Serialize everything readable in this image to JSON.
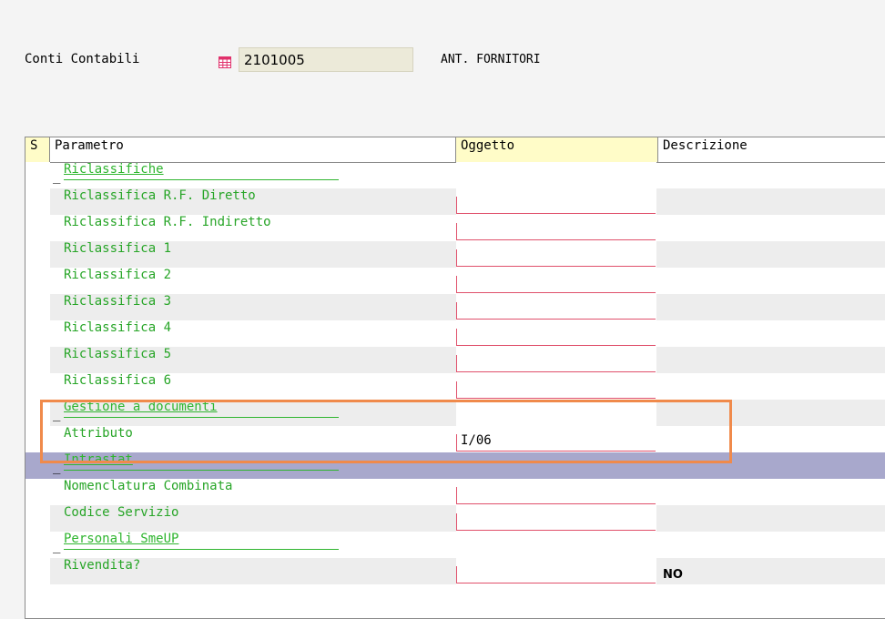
{
  "header": {
    "label": "Conti Contabili",
    "code": "2101005",
    "description": "ANT. FORNITORI"
  },
  "grid": {
    "columns": {
      "s": "S",
      "parametro": "Parametro",
      "oggetto": "Oggetto",
      "descrizione": "Descrizione"
    },
    "rows": [
      {
        "type": "section",
        "label": "Riclassifiche",
        "marker": "_"
      },
      {
        "type": "param",
        "label": "Riclassifica R.F. Diretto",
        "value": "",
        "desc": ""
      },
      {
        "type": "param",
        "label": "Riclassifica R.F. Indiretto",
        "value": "",
        "desc": ""
      },
      {
        "type": "param",
        "label": "Riclassifica 1",
        "value": "",
        "desc": ""
      },
      {
        "type": "param",
        "label": "Riclassifica 2",
        "value": "",
        "desc": ""
      },
      {
        "type": "param",
        "label": "Riclassifica 3",
        "value": "",
        "desc": ""
      },
      {
        "type": "param",
        "label": "Riclassifica 4",
        "value": "",
        "desc": ""
      },
      {
        "type": "param",
        "label": "Riclassifica 5",
        "value": "",
        "desc": ""
      },
      {
        "type": "param",
        "label": "Riclassifica 6",
        "value": "",
        "desc": ""
      },
      {
        "type": "section",
        "label": "Gestione a documenti",
        "marker": "_"
      },
      {
        "type": "param",
        "label": "Attributo",
        "value": "I/06",
        "desc": ""
      },
      {
        "type": "section",
        "label": "Intrastat",
        "marker": "_",
        "selected": true
      },
      {
        "type": "param",
        "label": "Nomenclatura Combinata",
        "value": "",
        "desc": ""
      },
      {
        "type": "param",
        "label": "Codice Servizio",
        "value": "",
        "desc": ""
      },
      {
        "type": "section",
        "label": "Personali SmeUP",
        "marker": "_"
      },
      {
        "type": "param",
        "label": "Rivendita?",
        "value": "",
        "desc": "NO"
      }
    ]
  },
  "icons": {
    "calendar": "calendar-icon"
  },
  "colors": {
    "accent_green": "#2fb52f",
    "field_border": "#e0506b",
    "highlight": "#f08a4b",
    "selection": "#a8a8cc"
  }
}
